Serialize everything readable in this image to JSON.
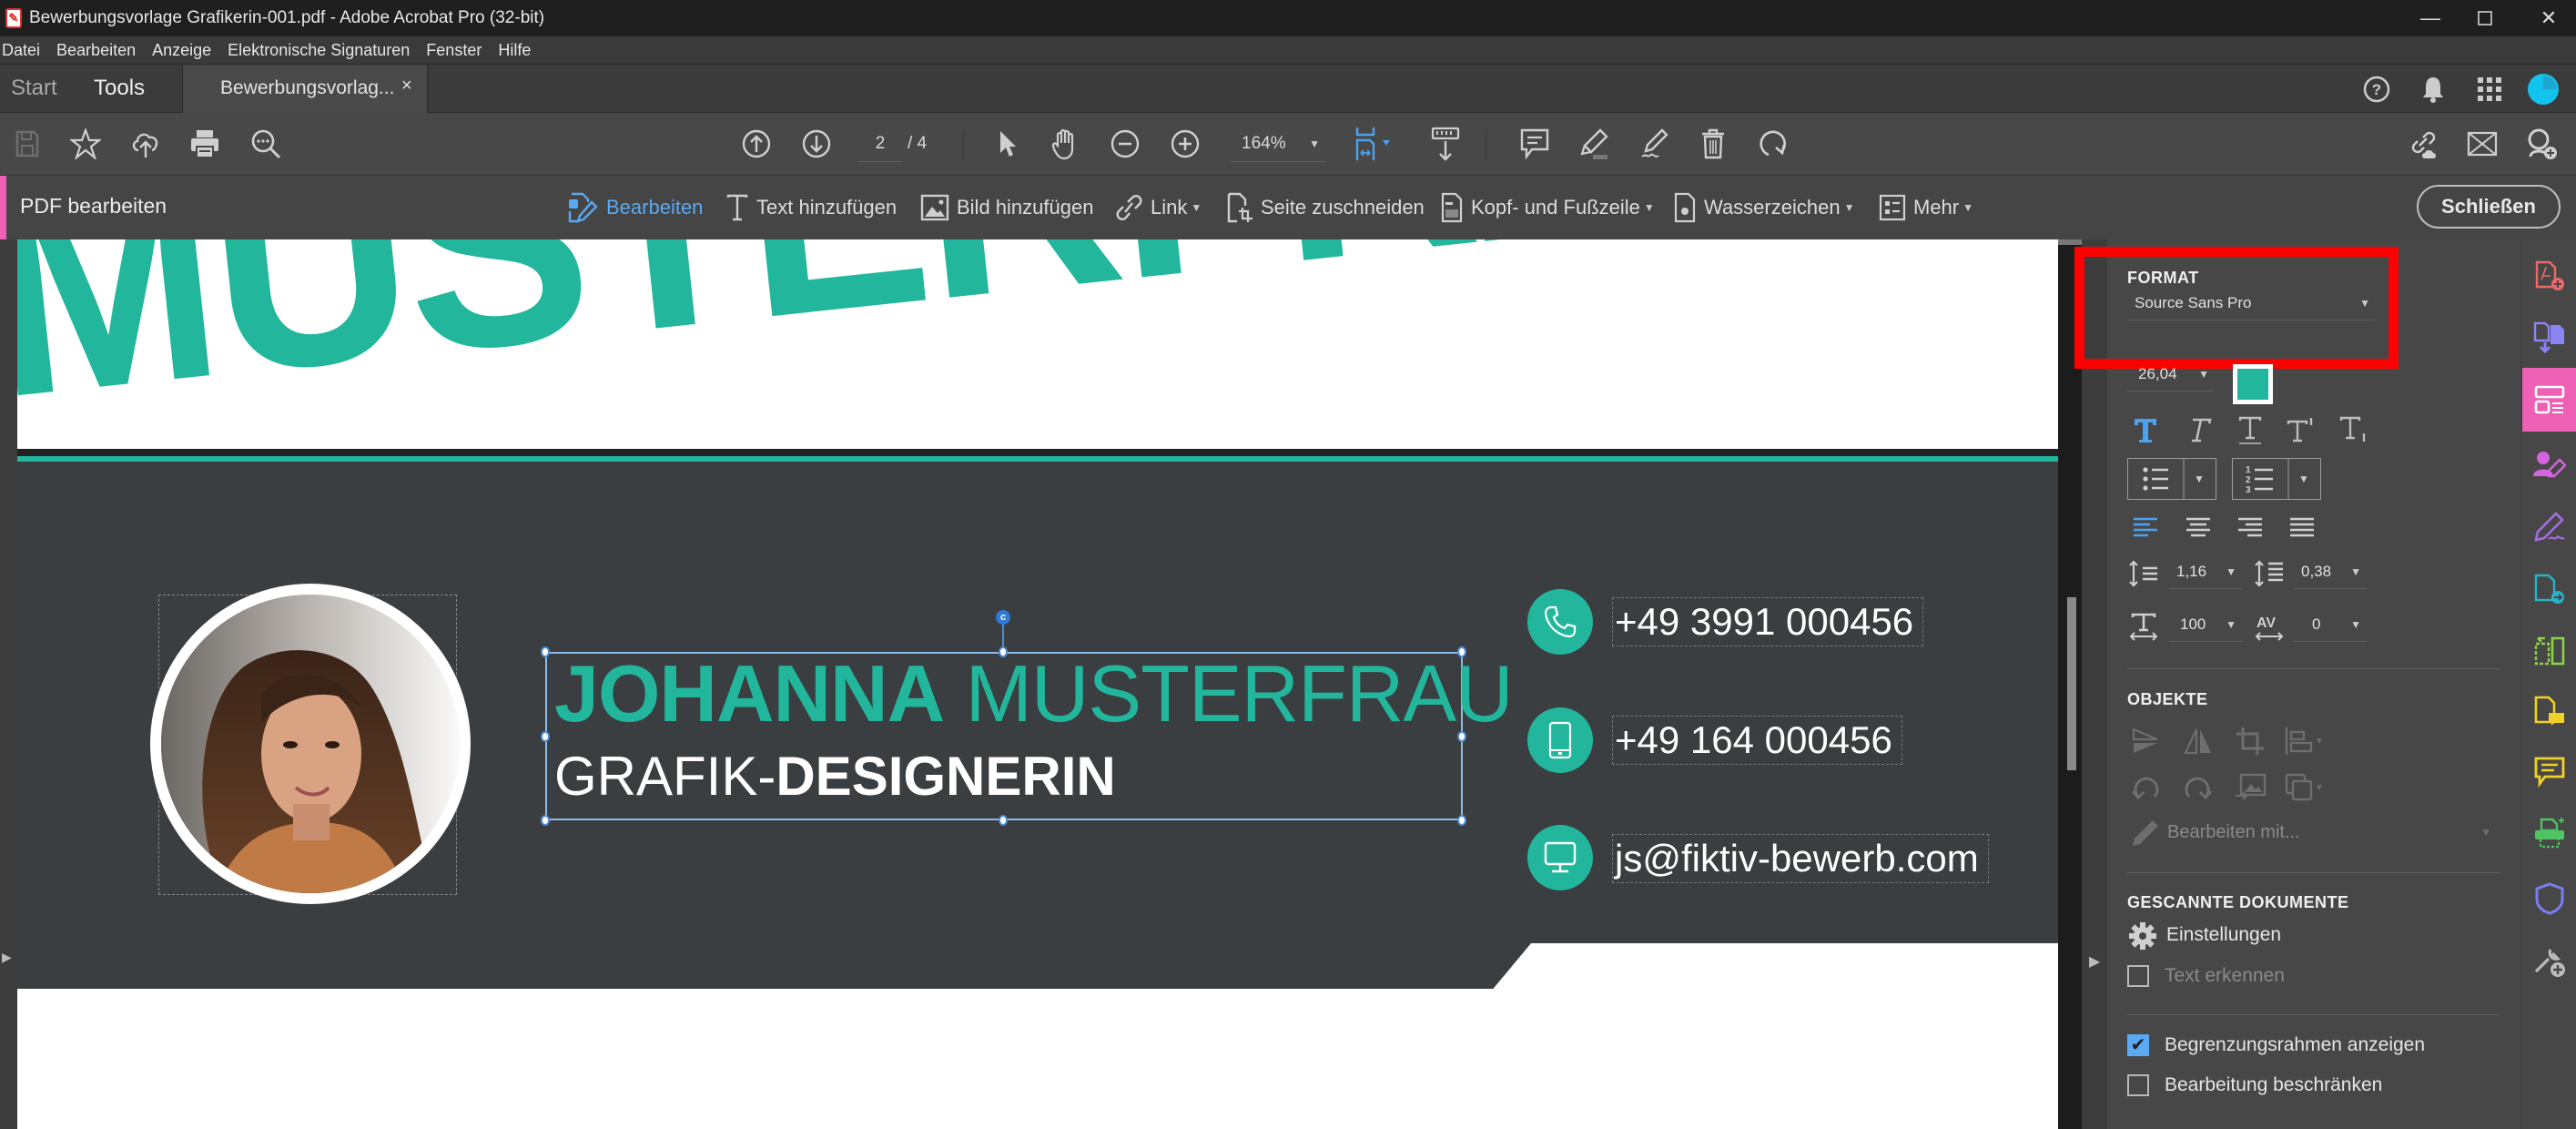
{
  "window": {
    "title": "Bewerbungsvorlage Grafikerin-001.pdf - Adobe Acrobat Pro (32-bit)",
    "controls": [
      "minimize",
      "maximize",
      "close"
    ]
  },
  "menu": [
    "Datei",
    "Bearbeiten",
    "Anzeige",
    "Elektronische Signaturen",
    "Fenster",
    "Hilfe"
  ],
  "tabs": {
    "start": "Start",
    "tools": "Tools",
    "document": "Bewerbungsvorlag...",
    "close": "×"
  },
  "toolbar": {
    "page_current": "2",
    "page_total": "/ 4",
    "zoom": "164%"
  },
  "editbar": {
    "title": "PDF bearbeiten",
    "items": [
      {
        "label": "Bearbeiten",
        "icon": "edit-icon",
        "active": true
      },
      {
        "label": "Text hinzufügen",
        "icon": "text-icon"
      },
      {
        "label": "Bild hinzufügen",
        "icon": "image-icon"
      },
      {
        "label": "Link",
        "icon": "link-icon",
        "dropdown": true
      },
      {
        "label": "Seite zuschneiden",
        "icon": "crop-page-icon"
      },
      {
        "label": "Kopf- und Fußzeile",
        "icon": "header-footer-icon",
        "dropdown": true
      },
      {
        "label": "Wasserzeichen",
        "icon": "watermark-icon",
        "dropdown": true
      },
      {
        "label": "Mehr",
        "icon": "more-icon",
        "dropdown": true
      }
    ],
    "close_label": "Schließen"
  },
  "document": {
    "banner": "MUSTERFRAU",
    "name_first": "JOHANNA",
    "name_last": "MUSTERFRAU",
    "role_light": "GRAFIK-",
    "role_bold": "DESIGNERIN",
    "rotate_handle": "c",
    "contacts": [
      {
        "icon": "phone-icon",
        "text": "+49 3991 000456"
      },
      {
        "icon": "mobile-icon",
        "text": "+49 164 000456"
      },
      {
        "icon": "monitor-icon",
        "text": "js@fiktiv-bewerb.com"
      }
    ],
    "colors": {
      "accent": "#22b79c",
      "dark": "#3b3e41"
    }
  },
  "panel": {
    "format": {
      "title": "FORMAT",
      "font": "Source Sans Pro",
      "size": "26,04",
      "color": "#22b79c",
      "line_spacing": "1,16",
      "paragraph_spacing": "0,38",
      "horizontal_scale": "100",
      "char_spacing": "0"
    },
    "objects": {
      "title": "OBJEKTE",
      "edit_with": "Bearbeiten mit..."
    },
    "scanned": {
      "title": "GESCANNTE DOKUMENTE",
      "settings": "Einstellungen",
      "recognize_text": "Text erkennen"
    },
    "options": [
      {
        "label": "Begrenzungsrahmen anzeigen",
        "checked": true
      },
      {
        "label": "Bearbeitung beschränken",
        "checked": false
      }
    ]
  },
  "rail": [
    {
      "name": "create-pdf-icon",
      "color": "#e96b6b"
    },
    {
      "name": "export-pdf-icon",
      "color": "#8b84f5"
    },
    {
      "name": "edit-pdf-icon",
      "color": "#ffffff",
      "active": true
    },
    {
      "name": "request-signature-icon",
      "color": "#d564e0"
    },
    {
      "name": "fill-sign-icon",
      "color": "#a56ee0"
    },
    {
      "name": "send-pdf-icon",
      "color": "#2ab3c6"
    },
    {
      "name": "organize-pages-icon",
      "color": "#8ed14a"
    },
    {
      "name": "comment-file-icon",
      "color": "#f1d129"
    },
    {
      "name": "comment-icon",
      "color": "#f1d129"
    },
    {
      "name": "scan-icon",
      "color": "#4ec462"
    },
    {
      "name": "protect-icon",
      "color": "#7b7df0"
    },
    {
      "name": "more-tools-icon",
      "color": "#bbbbbb"
    }
  ]
}
